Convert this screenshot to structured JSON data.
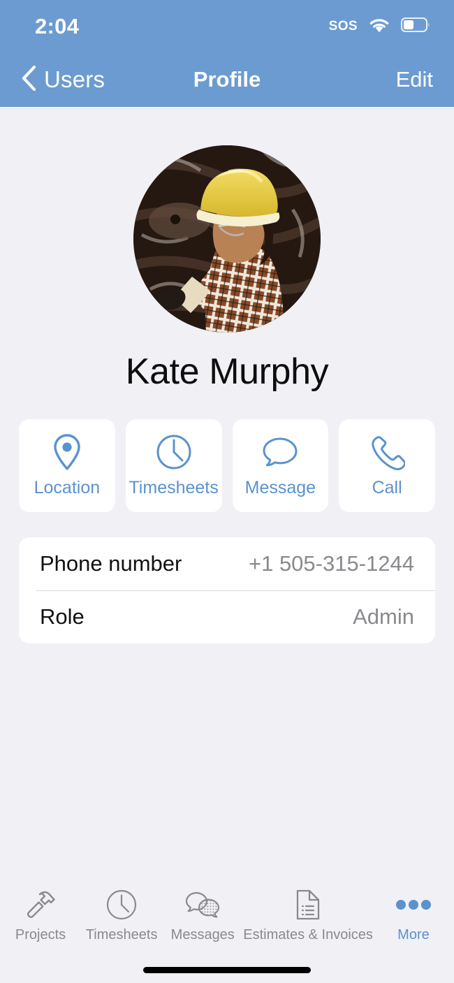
{
  "status_bar": {
    "time": "2:04",
    "sos_label": "SOS",
    "wifi_icon": "wifi-icon",
    "battery_icon": "battery-icon",
    "battery_level_pct": 40
  },
  "nav_bar": {
    "back_icon": "chevron-left-icon",
    "back_label": "Users",
    "title": "Profile",
    "edit_label": "Edit",
    "background_color": "#6B9BD1"
  },
  "profile": {
    "avatar_icon": "user-avatar-photo",
    "avatar_alt": "Construction worker wearing a yellow hard hat and plaid shirt",
    "name": "Kate Murphy"
  },
  "actions": [
    {
      "label": "Location",
      "icon": "map-pin-icon"
    },
    {
      "label": "Timesheets",
      "icon": "clock-icon"
    },
    {
      "label": "Message",
      "icon": "speech-bubble-icon"
    },
    {
      "label": "Call",
      "icon": "phone-handset-icon"
    }
  ],
  "info_rows": [
    {
      "label": "Phone number",
      "value": "+1 505-315-1244"
    },
    {
      "label": "Role",
      "value": "Admin"
    }
  ],
  "tab_bar": [
    {
      "label": "Projects",
      "icon": "hammer-icon",
      "active": false
    },
    {
      "label": "Timesheets",
      "icon": "clock-icon",
      "active": false
    },
    {
      "label": "Messages",
      "icon": "chat-bubbles-icon",
      "active": false
    },
    {
      "label": "Estimates & Invoices",
      "icon": "document-list-icon",
      "active": false
    },
    {
      "label": "More",
      "icon": "ellipsis-icon",
      "active": true
    }
  ],
  "theme": {
    "accent_color": "#5B92CE",
    "header_color": "#6B9BD1",
    "page_background": "#F0F0F5",
    "card_background": "#FFFFFF",
    "muted_text_color": "#8A8A8E",
    "primary_text_color": "#111111"
  }
}
